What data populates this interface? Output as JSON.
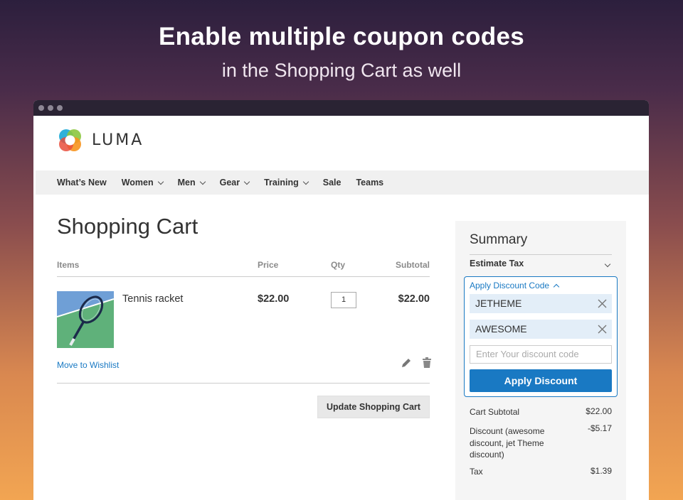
{
  "hero": {
    "title": "Enable multiple coupon codes",
    "subtitle": "in the Shopping Cart as well"
  },
  "site": {
    "logo_text": "LUMA"
  },
  "nav": {
    "items": [
      {
        "label": "What’s New",
        "has_dropdown": false
      },
      {
        "label": "Women",
        "has_dropdown": true
      },
      {
        "label": "Men",
        "has_dropdown": true
      },
      {
        "label": "Gear",
        "has_dropdown": true
      },
      {
        "label": "Training",
        "has_dropdown": true
      },
      {
        "label": "Sale",
        "has_dropdown": false
      },
      {
        "label": "Teams",
        "has_dropdown": false
      }
    ]
  },
  "cart": {
    "title": "Shopping Cart",
    "columns": {
      "items": "Items",
      "price": "Price",
      "qty": "Qty",
      "subtotal": "Subtotal"
    },
    "item": {
      "name": "Tennis racket",
      "price": "$22.00",
      "qty": "1",
      "subtotal": "$22.00",
      "wishlist_label": "Move to Wishlist",
      "image_icon": "tennis-racket-image"
    },
    "update_label": "Update Shopping Cart"
  },
  "summary": {
    "title": "Summary",
    "estimate_tax": "Estimate Tax",
    "discount": {
      "toggle_label": "Apply Discount Code",
      "codes": [
        "JETHEME",
        "AWESOME"
      ],
      "input_placeholder": "Enter Your discount code",
      "apply_label": "Apply Discount"
    },
    "totals": {
      "cart_subtotal_label": "Cart Subtotal",
      "cart_subtotal_value": "$22.00",
      "discount_label": "Discount (awesome discount, jet Theme discount)",
      "discount_value": "-$5.17",
      "tax_label": "Tax",
      "tax_value": "$1.39"
    }
  },
  "colors": {
    "accent": "#1979c3",
    "chip_bg": "#e3eef8",
    "nav_bg": "#f0f0f0",
    "summary_bg": "#f5f5f5"
  }
}
